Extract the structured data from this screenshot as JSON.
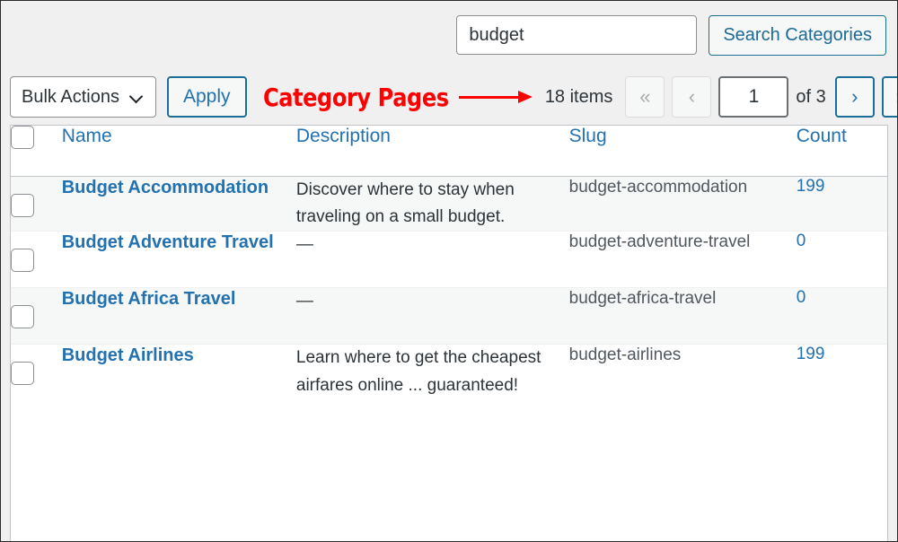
{
  "search": {
    "value": "budget",
    "placeholder": "Search Categories",
    "button_label": "Search Categories"
  },
  "toolbar": {
    "bulk_actions_label": "Bulk Actions",
    "apply_label": "Apply",
    "annotation_text": "Category Pages",
    "items_count": "18 items",
    "pagination": {
      "first_label": "«",
      "prev_label": "‹",
      "current_page": "1",
      "of_label": "of 3",
      "next_label": "›",
      "last_label": "»"
    }
  },
  "table": {
    "columns": [
      {
        "key": "name",
        "label": "Name"
      },
      {
        "key": "description",
        "label": "Description"
      },
      {
        "key": "slug",
        "label": "Slug"
      },
      {
        "key": "count",
        "label": "Count"
      }
    ],
    "rows": [
      {
        "name": "Budget Accommodation",
        "description": "Discover where to stay when traveling on a small budget.",
        "slug": "budget-accommodation",
        "count": "199"
      },
      {
        "name": "Budget Adventure Travel",
        "description": "—",
        "slug": "budget-adventure-travel",
        "count": "0"
      },
      {
        "name": "Budget Africa Travel",
        "description": "—",
        "slug": "budget-africa-travel",
        "count": "0"
      },
      {
        "name": "Budget Airlines",
        "description": "Learn where to get the cheapest airfares online ... guaranteed!",
        "slug": "budget-airlines",
        "count": "199"
      }
    ]
  },
  "colors": {
    "link": "#2271b1",
    "annotation": "#ff0000",
    "page_bg": "#f0f0f1",
    "row_alt_bg": "#f6f7f7",
    "border": "#c3c4c7"
  }
}
